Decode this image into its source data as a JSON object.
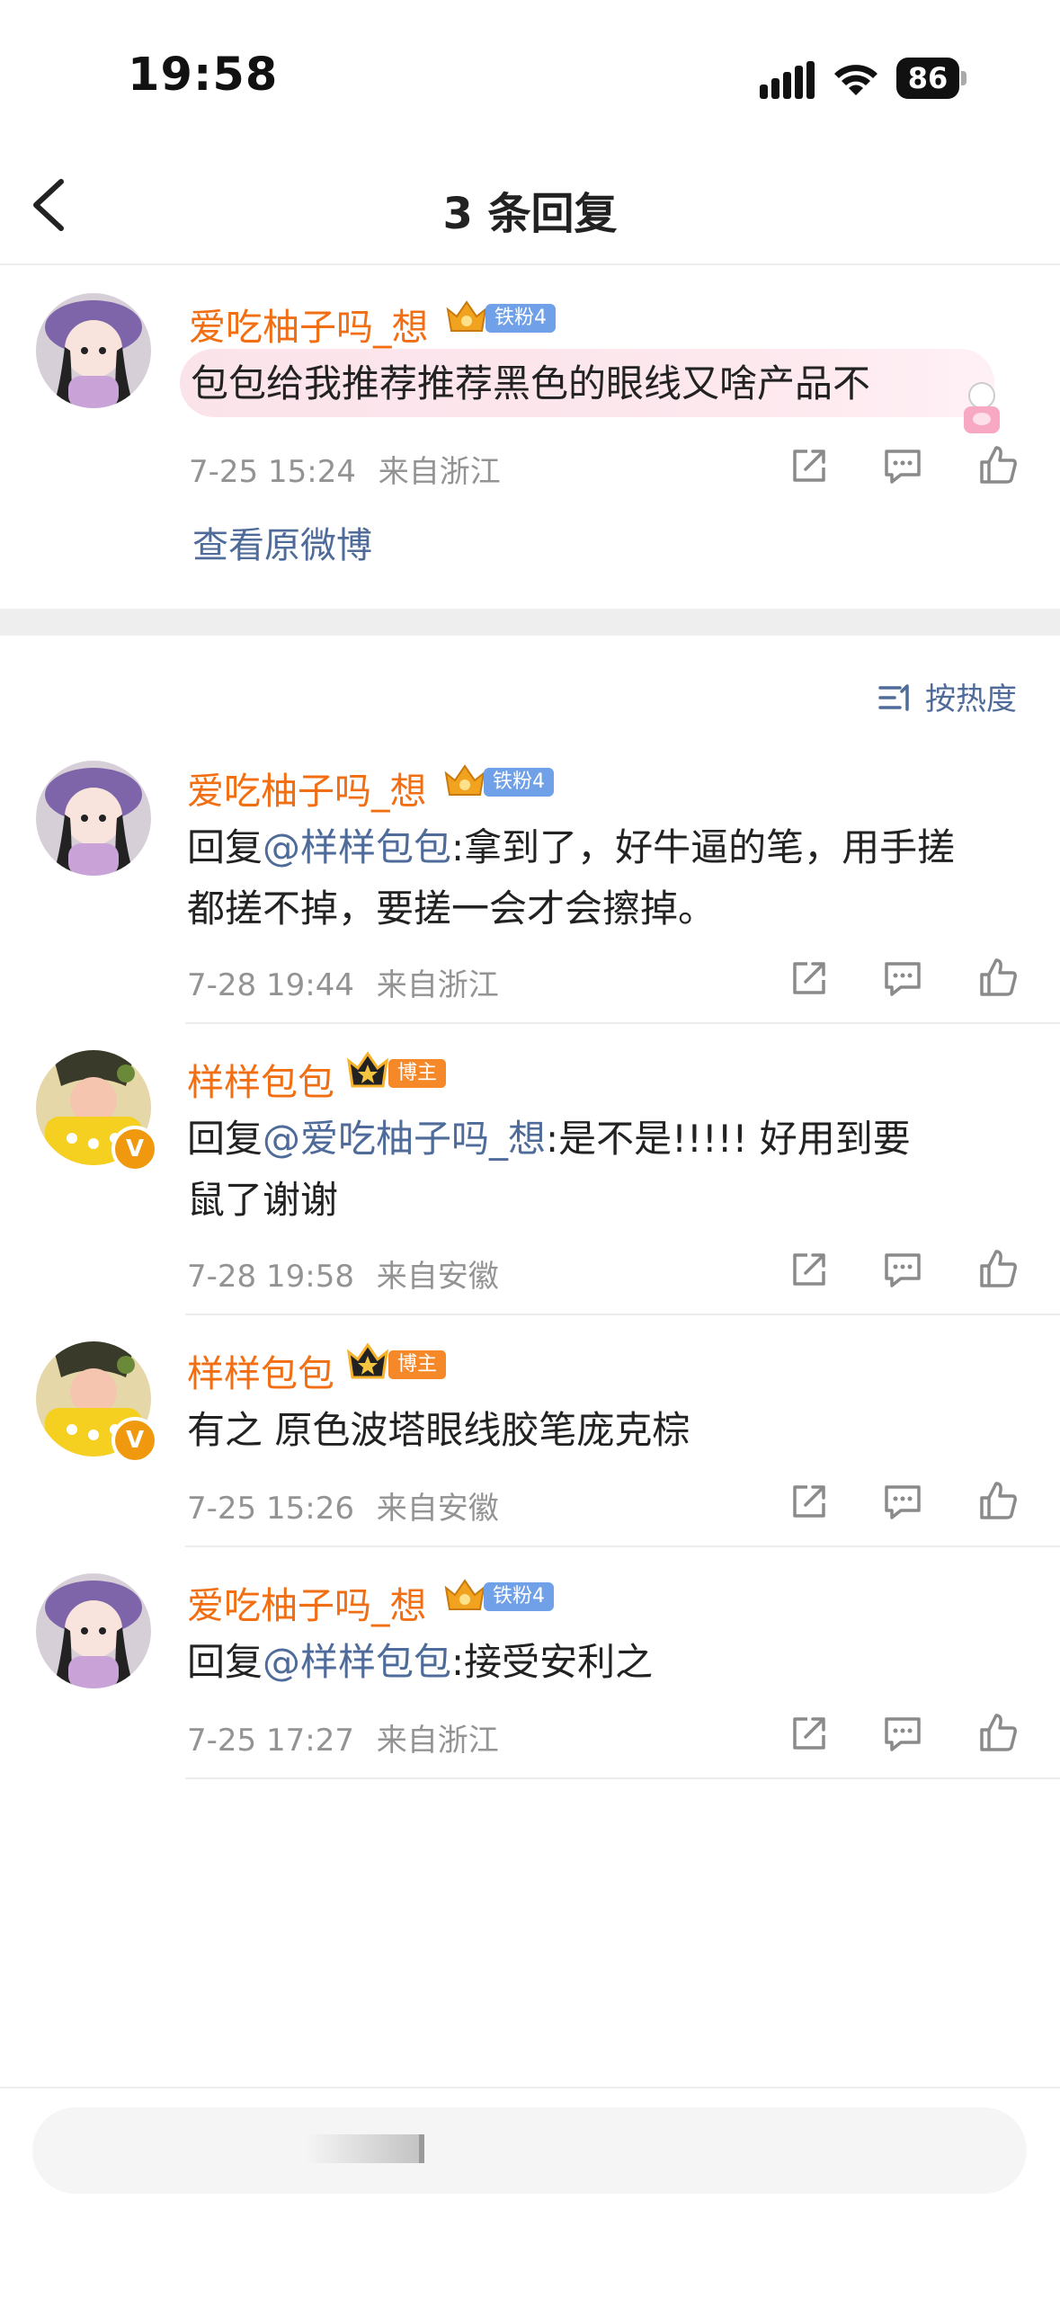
{
  "status_bar": {
    "time": "19:58",
    "battery": "86"
  },
  "nav": {
    "title": "3 条回复"
  },
  "root_comment": {
    "username": "爱吃柚子吗_想",
    "badge": "铁粉4",
    "text": "包包给我推荐推荐黑色的眼线又啥产品不",
    "date": "7-25 15:24",
    "location": "来自浙江",
    "view_original": "查看原微博"
  },
  "sort": {
    "label": "按热度"
  },
  "replies": [
    {
      "username": "爱吃柚子吗_想",
      "badge": "铁粉4",
      "prefix": "回复",
      "mention": "@样样包包",
      "line1": ":拿到了，好牛逼的笔，用手搓",
      "line2": "都搓不掉，要搓一会才会擦掉。",
      "date": "7-28 19:44",
      "location": "来自浙江"
    },
    {
      "username": "样样包包",
      "badge": "博主",
      "prefix": "回复",
      "mention": "@爱吃柚子吗_想",
      "line1": ":是不是!!!!!  好用到要",
      "line2": "鼠了谢谢",
      "date": "7-28 19:58",
      "location": "来自安徽"
    },
    {
      "username": "样样包包",
      "badge": "博主",
      "line1": "有之 原色波塔眼线胶笔庞克棕",
      "date": "7-25 15:26",
      "location": "来自安徽"
    },
    {
      "username": "爱吃柚子吗_想",
      "badge": "铁粉4",
      "prefix": "回复",
      "mention": "@样样包包",
      "line1": ":接受安利之",
      "date": "7-25 17:27",
      "location": "来自浙江"
    }
  ],
  "colors": {
    "username": "#f26e13",
    "mention": "#4e6b99",
    "meta": "#939393",
    "fan_badge": "#6fa0e8",
    "blogger_badge": "#f5892a",
    "verified": "#f0990f"
  }
}
